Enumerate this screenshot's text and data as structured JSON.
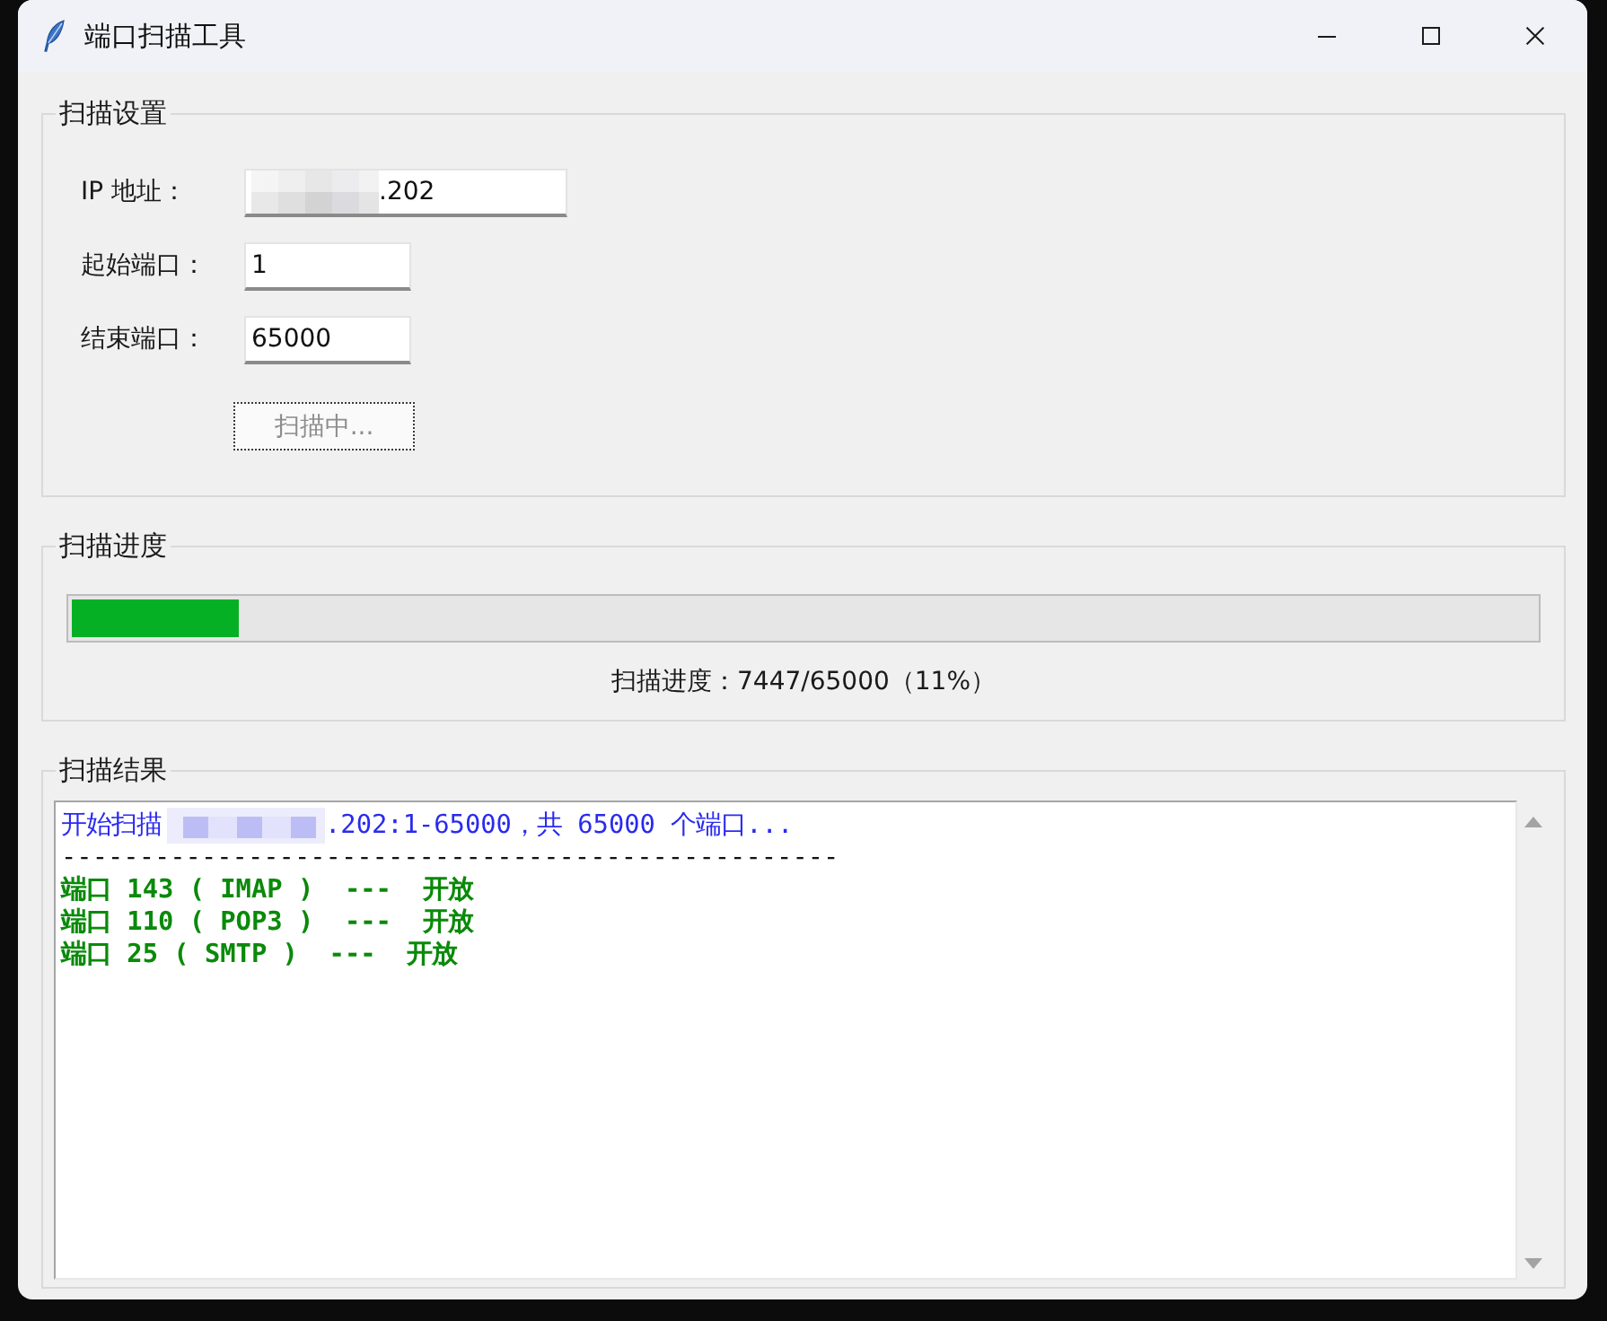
{
  "window": {
    "title": "端口扫描工具"
  },
  "settings": {
    "title": "扫描设置",
    "fields": [
      {
        "kind": "address",
        "label": "IP 地址：",
        "value": ".202",
        "redacted": true
      },
      {
        "kind": "port",
        "label": "起始端口：",
        "value": "1",
        "redacted": false
      },
      {
        "kind": "port",
        "label": "结束端口：",
        "value": "65000",
        "redacted": false
      }
    ],
    "button": {
      "label": "扫描中...",
      "disabled": true,
      "focused": true
    }
  },
  "progress": {
    "title": "扫描进度",
    "level": 0.1146,
    "text": "扫描进度：7447/65000（11%）"
  },
  "results": {
    "title": "扫描结果",
    "lines": [
      {
        "kind": "info",
        "text": "开始扫描",
        "redacted": true,
        "text_after": ".202:1-65000，共 65000 个端口..."
      },
      {
        "kind": "rule",
        "text": "--------------------------------------------------"
      },
      {
        "kind": "open",
        "text": "端口 143 ( IMAP )  ---  开放"
      },
      {
        "kind": "open",
        "text": "端口 110 ( POP3 )  ---  开放"
      },
      {
        "kind": "open",
        "text": "端口 25 ( SMTP )  ---  开放"
      }
    ]
  }
}
